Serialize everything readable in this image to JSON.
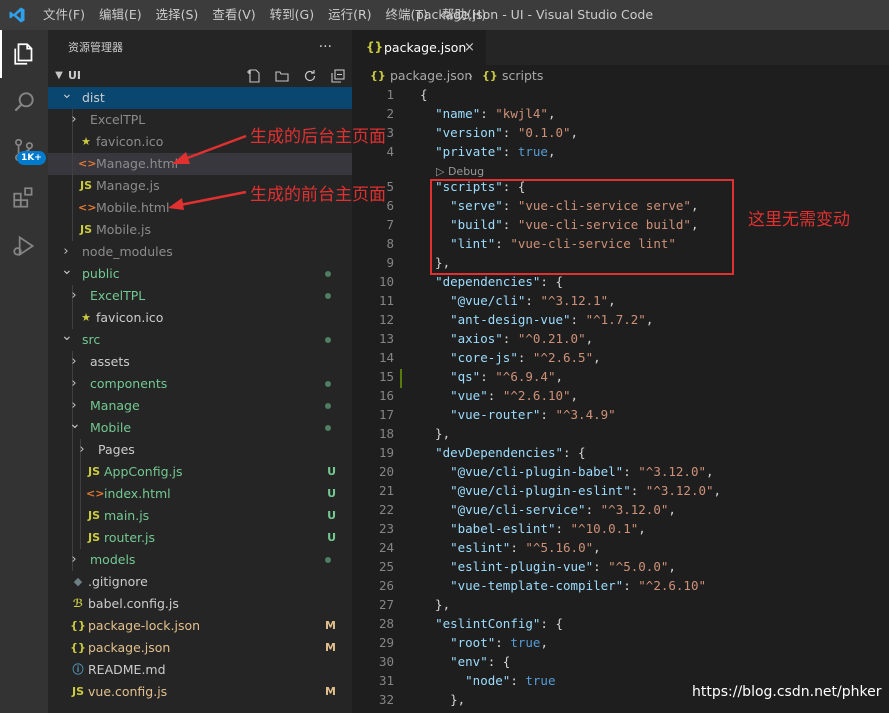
{
  "titlebar": {
    "menus": [
      "文件(F)",
      "编辑(E)",
      "选择(S)",
      "查看(V)",
      "转到(G)",
      "运行(R)",
      "终端(T)",
      "帮助(H)"
    ],
    "window_title": "package.json - UI - Visual Studio Code"
  },
  "activity_bar": {
    "items": [
      "explorer-icon",
      "search-icon",
      "source-control-icon",
      "extensions-icon",
      "run-debug-icon"
    ],
    "scm_badge": "1K+",
    "accent": "#007acc"
  },
  "sidebar": {
    "title": "资源管理器",
    "more": "···",
    "root": "UI",
    "tree": [
      {
        "label": "dist",
        "type": "folder",
        "open": true,
        "depth": 0,
        "color": "#cccccc",
        "selected": true
      },
      {
        "label": "ExcelTPL",
        "type": "folder",
        "open": false,
        "depth": 1,
        "color": "#8c8c8c"
      },
      {
        "label": "favicon.ico",
        "type": "star",
        "depth": 1,
        "color": "#8c8c8c"
      },
      {
        "label": "Manage.html",
        "type": "html",
        "depth": 1,
        "color": "#8c8c8c",
        "highlight": true
      },
      {
        "label": "Manage.js",
        "type": "js",
        "depth": 1,
        "color": "#8c8c8c"
      },
      {
        "label": "Mobile.html",
        "type": "html",
        "depth": 1,
        "color": "#8c8c8c"
      },
      {
        "label": "Mobile.js",
        "type": "js",
        "depth": 1,
        "color": "#8c8c8c"
      },
      {
        "label": "node_modules",
        "type": "folder",
        "open": false,
        "depth": 0,
        "color": "#8c8c8c"
      },
      {
        "label": "public",
        "type": "folder",
        "open": true,
        "depth": 0,
        "color": "#73c991",
        "dot": true
      },
      {
        "label": "ExcelTPL",
        "type": "folder",
        "open": false,
        "depth": 1,
        "color": "#73c991",
        "dot": true
      },
      {
        "label": "favicon.ico",
        "type": "star",
        "depth": 1,
        "color": "#cccccc"
      },
      {
        "label": "src",
        "type": "folder",
        "open": true,
        "depth": 0,
        "color": "#73c991",
        "dot": true
      },
      {
        "label": "assets",
        "type": "folder",
        "open": false,
        "depth": 1,
        "color": "#cccccc"
      },
      {
        "label": "components",
        "type": "folder",
        "open": false,
        "depth": 1,
        "color": "#73c991",
        "dot": true
      },
      {
        "label": "Manage",
        "type": "folder",
        "open": false,
        "depth": 1,
        "color": "#73c991",
        "dot": true
      },
      {
        "label": "Mobile",
        "type": "folder",
        "open": true,
        "depth": 1,
        "color": "#73c991",
        "dot": true
      },
      {
        "label": "Pages",
        "type": "folder",
        "open": false,
        "depth": 2,
        "color": "#cccccc"
      },
      {
        "label": "AppConfig.js",
        "type": "js",
        "depth": 2,
        "color": "#73c991",
        "status": "U"
      },
      {
        "label": "index.html",
        "type": "html",
        "depth": 2,
        "color": "#73c991",
        "status": "U"
      },
      {
        "label": "main.js",
        "type": "js",
        "depth": 2,
        "color": "#73c991",
        "status": "U"
      },
      {
        "label": "router.js",
        "type": "js",
        "depth": 2,
        "color": "#73c991",
        "status": "U"
      },
      {
        "label": "models",
        "type": "folder",
        "open": false,
        "depth": 1,
        "color": "#73c991",
        "dot": true
      },
      {
        "label": ".gitignore",
        "type": "git",
        "depth": 0,
        "color": "#cccccc"
      },
      {
        "label": "babel.config.js",
        "type": "babel",
        "depth": 0,
        "color": "#cccccc"
      },
      {
        "label": "package-lock.json",
        "type": "json",
        "depth": 0,
        "color": "#e2c08d",
        "status": "M"
      },
      {
        "label": "package.json",
        "type": "json",
        "depth": 0,
        "color": "#e2c08d",
        "status": "M"
      },
      {
        "label": "README.md",
        "type": "info",
        "depth": 0,
        "color": "#cccccc"
      },
      {
        "label": "vue.config.js",
        "type": "js",
        "depth": 0,
        "color": "#e2c08d",
        "status": "M"
      }
    ]
  },
  "editor": {
    "tab": {
      "icon": "{}",
      "label": "package.json",
      "close": "×"
    },
    "breadcrumb": {
      "icon1": "{}",
      "file": "package.json",
      "sep": "›",
      "icon2": "{}",
      "symbol": "scripts"
    },
    "codelens": "▷ Debug",
    "lines": [
      {
        "n": "1",
        "t": [
          [
            "p",
            "{"
          ]
        ]
      },
      {
        "n": "2",
        "t": [
          [
            "p",
            "  "
          ],
          [
            "k",
            "\"name\""
          ],
          [
            "p",
            ": "
          ],
          [
            "s",
            "\"kwjl4\""
          ],
          [
            "p",
            ","
          ]
        ]
      },
      {
        "n": "3",
        "t": [
          [
            "p",
            "  "
          ],
          [
            "k",
            "\"version\""
          ],
          [
            "p",
            ": "
          ],
          [
            "s",
            "\"0.1.0\""
          ],
          [
            "p",
            ","
          ]
        ]
      },
      {
        "n": "4",
        "t": [
          [
            "p",
            "  "
          ],
          [
            "k",
            "\"private\""
          ],
          [
            "p",
            ": "
          ],
          [
            "b",
            "true"
          ],
          [
            "p",
            ","
          ]
        ]
      },
      {
        "n": "5",
        "t": [
          [
            "p",
            "  "
          ],
          [
            "k",
            "\"scripts\""
          ],
          [
            "p",
            ": {"
          ]
        ]
      },
      {
        "n": "6",
        "t": [
          [
            "p",
            "    "
          ],
          [
            "k",
            "\"serve\""
          ],
          [
            "p",
            ": "
          ],
          [
            "s",
            "\"vue-cli-service serve\""
          ],
          [
            "p",
            ","
          ]
        ]
      },
      {
        "n": "7",
        "t": [
          [
            "p",
            "    "
          ],
          [
            "k",
            "\"build\""
          ],
          [
            "p",
            ": "
          ],
          [
            "s",
            "\"vue-cli-service build\""
          ],
          [
            "p",
            ","
          ]
        ]
      },
      {
        "n": "8",
        "t": [
          [
            "p",
            "    "
          ],
          [
            "k",
            "\"lint\""
          ],
          [
            "p",
            ": "
          ],
          [
            "s",
            "\"vue-cli-service lint\""
          ]
        ]
      },
      {
        "n": "9",
        "t": [
          [
            "p",
            "  },"
          ]
        ]
      },
      {
        "n": "10",
        "t": [
          [
            "p",
            "  "
          ],
          [
            "k",
            "\"dependencies\""
          ],
          [
            "p",
            ": {"
          ]
        ]
      },
      {
        "n": "11",
        "t": [
          [
            "p",
            "    "
          ],
          [
            "k",
            "\"@vue/cli\""
          ],
          [
            "p",
            ": "
          ],
          [
            "s",
            "\"^3.12.1\""
          ],
          [
            "p",
            ","
          ]
        ]
      },
      {
        "n": "12",
        "t": [
          [
            "p",
            "    "
          ],
          [
            "k",
            "\"ant-design-vue\""
          ],
          [
            "p",
            ": "
          ],
          [
            "s",
            "\"^1.7.2\""
          ],
          [
            "p",
            ","
          ]
        ]
      },
      {
        "n": "13",
        "t": [
          [
            "p",
            "    "
          ],
          [
            "k",
            "\"axios\""
          ],
          [
            "p",
            ": "
          ],
          [
            "s",
            "\"^0.21.0\""
          ],
          [
            "p",
            ","
          ]
        ]
      },
      {
        "n": "14",
        "t": [
          [
            "p",
            "    "
          ],
          [
            "k",
            "\"core-js\""
          ],
          [
            "p",
            ": "
          ],
          [
            "s",
            "\"^2.6.5\""
          ],
          [
            "p",
            ","
          ]
        ]
      },
      {
        "n": "15",
        "t": [
          [
            "p",
            "    "
          ],
          [
            "k",
            "\"qs\""
          ],
          [
            "p",
            ": "
          ],
          [
            "s",
            "\"^6.9.4\""
          ],
          [
            "p",
            ","
          ]
        ]
      },
      {
        "n": "16",
        "t": [
          [
            "p",
            "    "
          ],
          [
            "k",
            "\"vue\""
          ],
          [
            "p",
            ": "
          ],
          [
            "s",
            "\"^2.6.10\""
          ],
          [
            "p",
            ","
          ]
        ]
      },
      {
        "n": "17",
        "t": [
          [
            "p",
            "    "
          ],
          [
            "k",
            "\"vue-router\""
          ],
          [
            "p",
            ": "
          ],
          [
            "s",
            "\"^3.4.9\""
          ]
        ]
      },
      {
        "n": "18",
        "t": [
          [
            "p",
            "  },"
          ]
        ]
      },
      {
        "n": "19",
        "t": [
          [
            "p",
            "  "
          ],
          [
            "k",
            "\"devDependencies\""
          ],
          [
            "p",
            ": {"
          ]
        ]
      },
      {
        "n": "20",
        "t": [
          [
            "p",
            "    "
          ],
          [
            "k",
            "\"@vue/cli-plugin-babel\""
          ],
          [
            "p",
            ": "
          ],
          [
            "s",
            "\"^3.12.0\""
          ],
          [
            "p",
            ","
          ]
        ]
      },
      {
        "n": "21",
        "t": [
          [
            "p",
            "    "
          ],
          [
            "k",
            "\"@vue/cli-plugin-eslint\""
          ],
          [
            "p",
            ": "
          ],
          [
            "s",
            "\"^3.12.0\""
          ],
          [
            "p",
            ","
          ]
        ]
      },
      {
        "n": "22",
        "t": [
          [
            "p",
            "    "
          ],
          [
            "k",
            "\"@vue/cli-service\""
          ],
          [
            "p",
            ": "
          ],
          [
            "s",
            "\"^3.12.0\""
          ],
          [
            "p",
            ","
          ]
        ]
      },
      {
        "n": "23",
        "t": [
          [
            "p",
            "    "
          ],
          [
            "k",
            "\"babel-eslint\""
          ],
          [
            "p",
            ": "
          ],
          [
            "s",
            "\"^10.0.1\""
          ],
          [
            "p",
            ","
          ]
        ]
      },
      {
        "n": "24",
        "t": [
          [
            "p",
            "    "
          ],
          [
            "k",
            "\"eslint\""
          ],
          [
            "p",
            ": "
          ],
          [
            "s",
            "\"^5.16.0\""
          ],
          [
            "p",
            ","
          ]
        ]
      },
      {
        "n": "25",
        "t": [
          [
            "p",
            "    "
          ],
          [
            "k",
            "\"eslint-plugin-vue\""
          ],
          [
            "p",
            ": "
          ],
          [
            "s",
            "\"^5.0.0\""
          ],
          [
            "p",
            ","
          ]
        ]
      },
      {
        "n": "26",
        "t": [
          [
            "p",
            "    "
          ],
          [
            "k",
            "\"vue-template-compiler\""
          ],
          [
            "p",
            ": "
          ],
          [
            "s",
            "\"^2.6.10\""
          ]
        ]
      },
      {
        "n": "27",
        "t": [
          [
            "p",
            "  },"
          ]
        ]
      },
      {
        "n": "28",
        "t": [
          [
            "p",
            "  "
          ],
          [
            "k",
            "\"eslintConfig\""
          ],
          [
            "p",
            ": {"
          ]
        ]
      },
      {
        "n": "29",
        "t": [
          [
            "p",
            "    "
          ],
          [
            "k",
            "\"root\""
          ],
          [
            "p",
            ": "
          ],
          [
            "b",
            "true"
          ],
          [
            "p",
            ","
          ]
        ]
      },
      {
        "n": "30",
        "t": [
          [
            "p",
            "    "
          ],
          [
            "k",
            "\"env\""
          ],
          [
            "p",
            ": {"
          ]
        ]
      },
      {
        "n": "31",
        "t": [
          [
            "p",
            "      "
          ],
          [
            "k",
            "\"node\""
          ],
          [
            "p",
            ": "
          ],
          [
            "b",
            "true"
          ]
        ]
      },
      {
        "n": "32",
        "t": [
          [
            "p",
            "    },"
          ]
        ]
      }
    ]
  },
  "annotations": {
    "backend_note": "生成的后台主页面",
    "frontend_note": "生成的前台主页面",
    "scripts_note": "这里无需变动",
    "color": "#e03030"
  },
  "watermark": "https://blog.csdn.net/phker"
}
